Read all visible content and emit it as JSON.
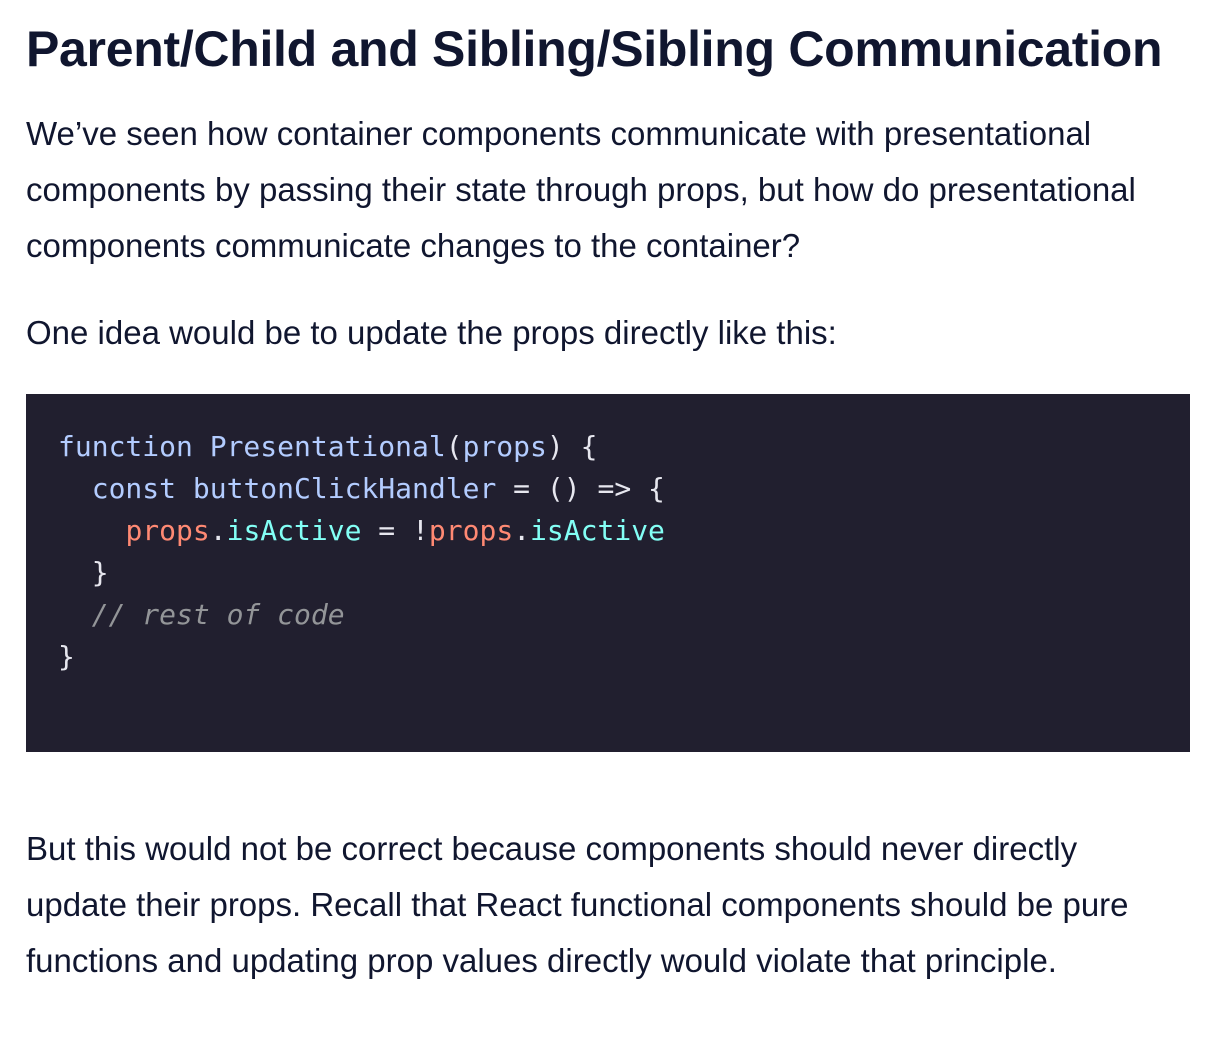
{
  "heading": "Parent/Child and Sibling/Sibling Communication",
  "paragraph_1": "We’ve seen how container components communicate with presentational components by passing their state through props, but how do presentational components communicate changes to the container?",
  "paragraph_2": "One idea would be to update the props directly like this:",
  "code": {
    "language": "javascript",
    "line_1": {
      "keyword": "function",
      "func_name": "Presentational",
      "open_paren": "(",
      "param": "props",
      "close": ") {"
    },
    "line_2": {
      "keyword": "const",
      "name": "buttonClickHandler",
      "rest": " = () => {"
    },
    "line_3": {
      "obj_1": "props",
      "dot_1": ".",
      "prop_1": "isActive",
      "op": " = !",
      "obj_2": "props",
      "dot_2": ".",
      "prop_2": "isActive"
    },
    "line_4": "}",
    "line_5": "// rest of code",
    "line_6": "}"
  },
  "paragraph_3": "But this would not be correct because components should never directly update their props. Recall that React functional components should be pure functions and updating prop values directly would violate that principle."
}
